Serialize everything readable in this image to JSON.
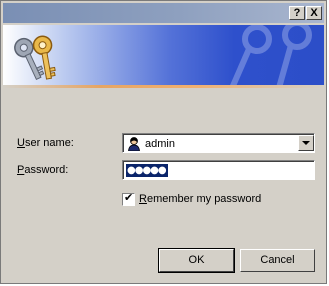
{
  "titlebar": {
    "help_label": "?",
    "close_label": "X"
  },
  "form": {
    "username_label_u": "U",
    "username_label_rest": "ser name:",
    "username_value": "admin",
    "password_label_u": "P",
    "password_label_rest": "assword:",
    "password_mask": "●●●●●",
    "remember_label_u": "R",
    "remember_label_rest": "emember my password",
    "remember_checked": true,
    "check_glyph": "✔"
  },
  "buttons": {
    "ok_label": "OK",
    "cancel_label": "Cancel"
  },
  "icons": {
    "banner": "keys-icon",
    "user": "user-icon",
    "dropdown": "chevron-down-icon"
  },
  "colors": {
    "dialog_bg": "#d4d0c8",
    "banner_blue": "#2e50cc",
    "selection": "#0a246a"
  }
}
